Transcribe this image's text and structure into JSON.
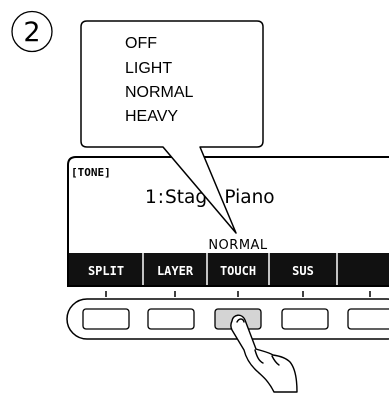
{
  "step_number": "2",
  "callout_options": [
    "OFF",
    "LIGHT",
    "NORMAL",
    "HEAVY"
  ],
  "lcd": {
    "title": "[TONE]",
    "tone_number": "1",
    "tone_separator": ":",
    "tone_name": "Stage Piano",
    "current_value": "NORMAL",
    "softkeys": [
      "SPLIT",
      "LAYER",
      "TOUCH",
      "SUS",
      ""
    ]
  },
  "pressed_button": "TOUCH",
  "colors": {
    "line": "#000000",
    "softkey_bar": "#111111",
    "softkey_text": "#ffffff",
    "pressed_button_fill": "#d4d4d4",
    "button_fill": "#ffffff"
  }
}
